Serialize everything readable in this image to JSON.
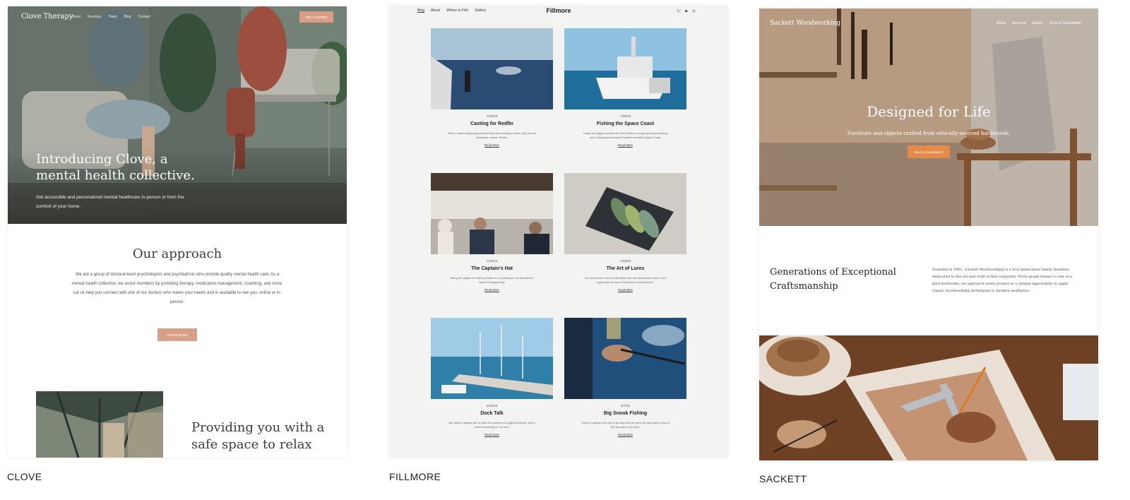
{
  "templates": [
    {
      "id": "clove",
      "label": "CLOVE",
      "nav": {
        "logo": "Clove Therapy",
        "links": [
          "About",
          "Services",
          "Team",
          "Blog",
          "Contact"
        ],
        "cta": "GET STARTED"
      },
      "hero": {
        "title": "Introducing Clove, a mental health collective.",
        "subtitle": "Get accessible and personalized mental healthcare in-person or from the comfort of your home."
      },
      "approach": {
        "title": "Our approach",
        "body": "We are a group of doctoral-level psychologists and psychiatrists who provide quality mental health care. As a mental health collective, we assist members by providing therapy, medication management, coaching, and more. Let us help you connect with one of our doctors who meets your needs and is available to see you, online or in-person.",
        "button": "LEARN MORE"
      },
      "feature": {
        "title": "Providing you with a safe space to relax"
      }
    },
    {
      "id": "fillmore",
      "label": "FILLMORE",
      "nav": {
        "logo": "Fillmore",
        "links": [
          "Blog",
          "About",
          "Where to Fish",
          "Gallery"
        ],
        "socials": [
          "twitter-icon",
          "youtube-icon",
          "instagram-icon"
        ]
      },
      "posts": [
        {
          "date": "7/20/19",
          "title": "Casting for Redfin",
          "excerpt": "When I asked today's guests what they were looking to catch, they had an immediate answer: Redfin.",
          "more": "Read More"
        },
        {
          "date": "7/20/19",
          "title": "Fishing the Space Coast",
          "excerpt": "Today, we tagged a school off Cocoa Beach to enjoy some good fishing and a history lesson about Florida's incredible Space Coast.",
          "more": "Read More"
        },
        {
          "date": "7/19/19",
          "title": "The Captain's Hat",
          "excerpt": "Being the captain of a fishing charter is my dream job, but that doesn't mean it's always easy.",
          "more": "Read More"
        },
        {
          "date": "7/19/19",
          "title": "The Art of Lures",
          "excerpt": "I've never been much of a fly fisherman, but that doesn't mean I can't appreciate the work of art that is a well tied lure.",
          "more": "Read More"
        },
        {
          "date": "6/18/19",
          "title": "Dock Talk",
          "excerpt": "We charter captains like to think of ourselves as a tight-knit bunch, with a whole vocabulary of our own.",
          "more": "Read More"
        },
        {
          "date": "6/7/19",
          "title": "Big Snook Fishing",
          "excerpt": "Snook is always a fun fish to go after and we spent the day taking a few of the big ones in the boat.",
          "more": "Read More"
        }
      ]
    },
    {
      "id": "sackett",
      "label": "SACKETT",
      "nav": {
        "logo": "Sackett Woodworking",
        "links": [
          "About",
          "Services",
          "Gallery",
          "Book a Consultation"
        ]
      },
      "hero": {
        "title": "Designed for Life",
        "subtitle": "Furniture and objects crafted from ethically-sourced hardwoods.",
        "cta": "Book a Consultation"
      },
      "about": {
        "title": "Generations of Exceptional Craftsmanship",
        "body": "Founded in 1901, Sackett Woodworking is a four-generation family business dedicated to the art and craft of fine carpentry. From grand homes to one of a kind heirlooms, we approach every project as a unique opportunity to apply classic woodworking techniques to modern aesthetics."
      }
    }
  ],
  "colors": {
    "clove_accent": "#d99f86",
    "sackett_accent": "#e48a4a"
  }
}
